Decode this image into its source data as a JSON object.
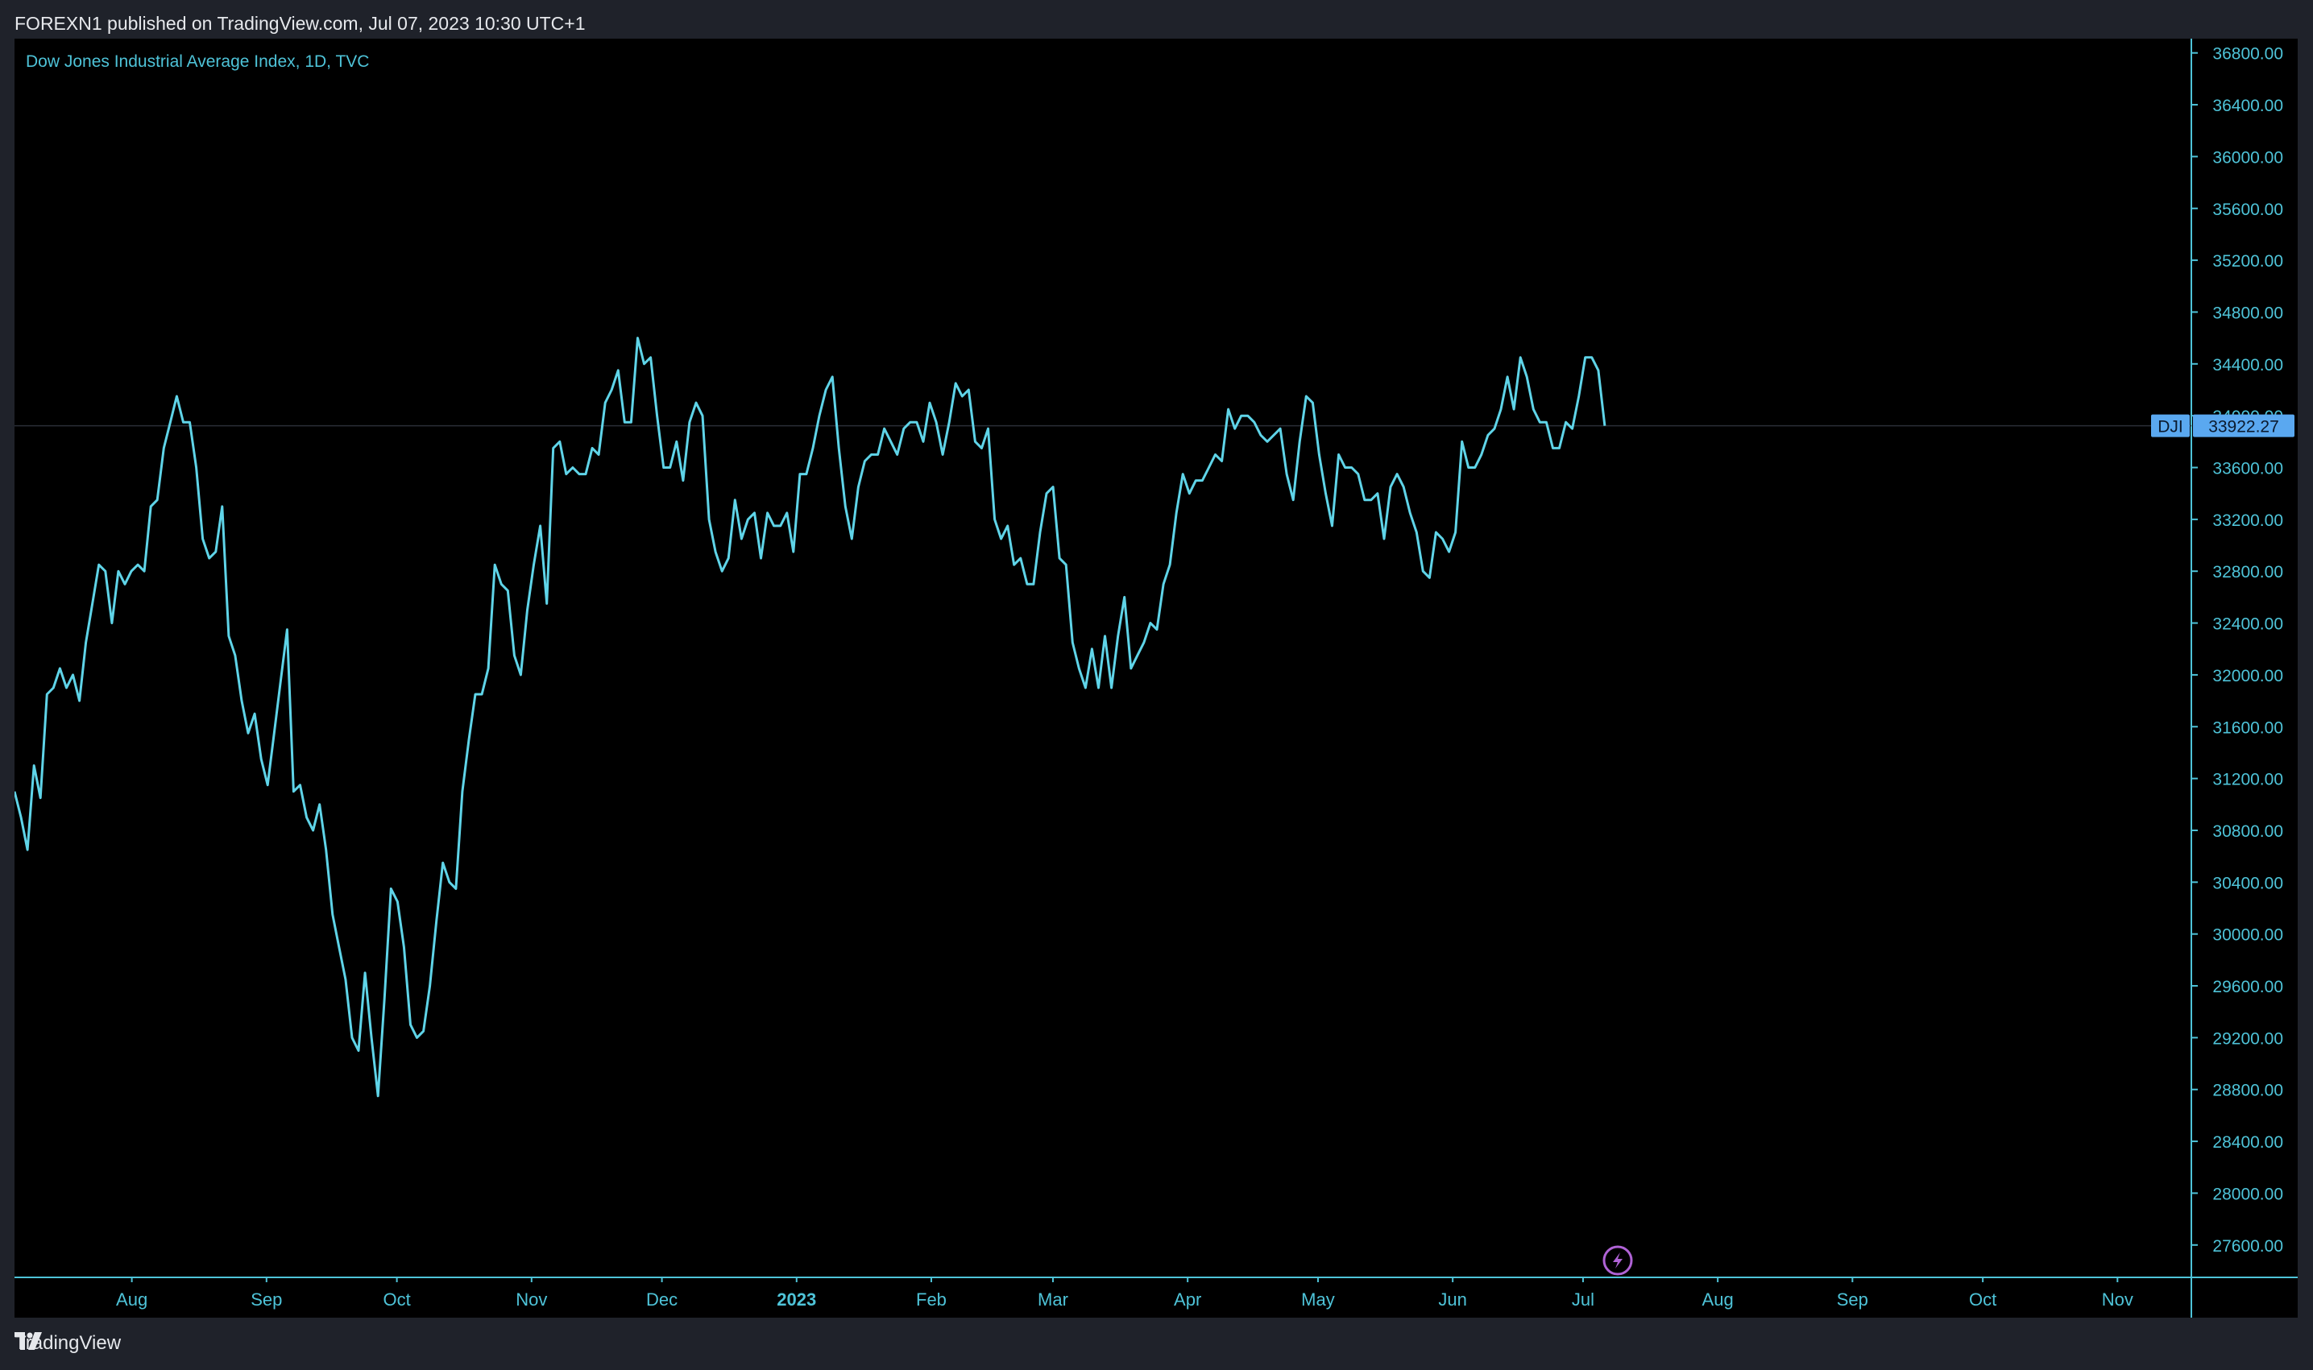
{
  "header": {
    "published_text": "FOREXN1 published on TradingView.com, Jul 07, 2023 10:30 UTC+1"
  },
  "footer": {
    "brand": "TradingView",
    "logo_icon": "tradingview-logo-icon"
  },
  "colors": {
    "line": "#5fd4e8",
    "axis_text": "#4ec3d8",
    "background": "#000000",
    "outer": "#1f222a",
    "price_badge": "#5aa8f0",
    "price_badge_text": "#0b1a2e",
    "lightning": "#b063d6"
  },
  "icons": {
    "lightning": "lightning-icon"
  },
  "chart_data": {
    "type": "line",
    "title": "Dow Jones Industrial Average Index, 1D, TVC",
    "series": [
      {
        "name": "DJI",
        "x_start": "2022-07-05",
        "x_end": "2023-07-06",
        "values": [
          31100,
          30900,
          30650,
          31300,
          31050,
          31850,
          31900,
          32050,
          31900,
          32000,
          31800,
          32250,
          32550,
          32850,
          32800,
          32400,
          32800,
          32700,
          32800,
          32850,
          32800,
          33300,
          33350,
          33750,
          33950,
          34150,
          33950,
          33950,
          33600,
          33050,
          32900,
          32950,
          33300,
          32300,
          32150,
          31800,
          31550,
          31700,
          31350,
          31150,
          31550,
          31950,
          32350,
          31100,
          31150,
          30900,
          30800,
          31000,
          30650,
          30150,
          29900,
          29650,
          29200,
          29100,
          29700,
          29200,
          28750,
          29500,
          30350,
          30250,
          29900,
          29300,
          29200,
          29250,
          29600,
          30100,
          30550,
          30400,
          30350,
          31100,
          31500,
          31850,
          31850,
          32050,
          32850,
          32700,
          32650,
          32150,
          32000,
          32500,
          32850,
          33150,
          32550,
          33750,
          33800,
          33550,
          33600,
          33550,
          33550,
          33750,
          33700,
          34100,
          34200,
          34350,
          33950,
          33950,
          34600,
          34400,
          34450,
          34000,
          33600,
          33600,
          33800,
          33500,
          33950,
          34100,
          34000,
          33200,
          32950,
          32800,
          32900,
          33350,
          33050,
          33200,
          33250,
          32900,
          33250,
          33150,
          33150,
          33250,
          32950,
          33550,
          33550,
          33750,
          34000,
          34200,
          34300,
          33750,
          33300,
          33050,
          33450,
          33650,
          33700,
          33700,
          33900,
          33800,
          33700,
          33900,
          33950,
          33950,
          33800,
          34100,
          33950,
          33700,
          33950,
          34250,
          34150,
          34200,
          33800,
          33750,
          33900,
          33200,
          33050,
          33150,
          32850,
          32900,
          32700,
          32700,
          33100,
          33400,
          33450,
          32900,
          32850,
          32250,
          32050,
          31900,
          32200,
          31900,
          32300,
          31900,
          32300,
          32600,
          32050,
          32150,
          32250,
          32400,
          32350,
          32700,
          32850,
          33250,
          33550,
          33400,
          33500,
          33500,
          33600,
          33700,
          33650,
          34050,
          33900,
          34000,
          34000,
          33950,
          33850,
          33800,
          33850,
          33900,
          33550,
          33350,
          33800,
          34150,
          34100,
          33700,
          33400,
          33150,
          33700,
          33600,
          33600,
          33550,
          33350,
          33350,
          33400,
          33050,
          33450,
          33550,
          33450,
          33250,
          33100,
          32800,
          32750,
          33100,
          33050,
          32950,
          33100,
          33800,
          33600,
          33600,
          33700,
          33850,
          33900,
          34050,
          34300,
          34050,
          34450,
          34300,
          34050,
          33950,
          33950,
          33750,
          33750,
          33950,
          33900,
          34150,
          34450,
          34450,
          34350,
          33922.27
        ]
      }
    ],
    "last_value": "33922.27",
    "last_label": "DJI",
    "x_ticks": [
      "Aug",
      "Sep",
      "Oct",
      "Nov",
      "Dec",
      "2023",
      "Feb",
      "Mar",
      "Apr",
      "May",
      "Jun",
      "Jul",
      "Aug",
      "Sep",
      "Oct",
      "Nov"
    ],
    "x_tick_dates": [
      "2022-08-01",
      "2022-09-01",
      "2022-10-01",
      "2022-11-01",
      "2022-12-01",
      "2023-01-01",
      "2023-02-01",
      "2023-03-01",
      "2023-04-01",
      "2023-05-01",
      "2023-06-01",
      "2023-07-01",
      "2023-08-01",
      "2023-09-01",
      "2023-10-01",
      "2023-11-01"
    ],
    "x_range": [
      "2022-07-05",
      "2023-11-18"
    ],
    "y_ticks": [
      "36800.00",
      "36400.00",
      "36000.00",
      "35600.00",
      "35200.00",
      "34800.00",
      "34400.00",
      "34000.00",
      "33600.00",
      "33200.00",
      "32800.00",
      "32400.00",
      "32000.00",
      "31600.00",
      "31200.00",
      "30800.00",
      "30400.00",
      "30000.00",
      "29600.00",
      "29200.00",
      "28800.00",
      "28400.00",
      "28000.00",
      "27600.00"
    ],
    "ylim": [
      27350,
      36910
    ],
    "grid": false,
    "y_axis_position": "right",
    "xlabel": "",
    "ylabel": ""
  }
}
